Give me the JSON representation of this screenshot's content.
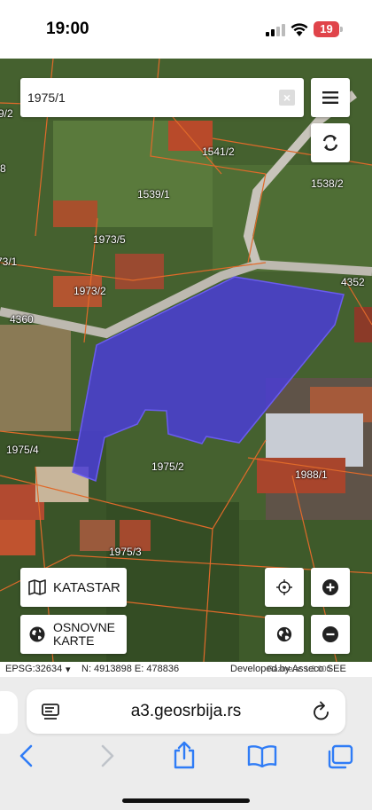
{
  "status_bar": {
    "time": "19:00",
    "battery": "19"
  },
  "search": {
    "value": "1975/1"
  },
  "parcels": [
    {
      "id": "p1",
      "label": "9/2"
    },
    {
      "id": "p2",
      "label": "1541/2"
    },
    {
      "id": "p3",
      "label": "8"
    },
    {
      "id": "p4",
      "label": "1538/2"
    },
    {
      "id": "p5",
      "label": "1539/1"
    },
    {
      "id": "p6",
      "label": "1973/5"
    },
    {
      "id": "p7",
      "label": "73/1"
    },
    {
      "id": "p8",
      "label": "1973/2"
    },
    {
      "id": "p9",
      "label": "4352"
    },
    {
      "id": "p10",
      "label": "4360"
    },
    {
      "id": "p11",
      "label": "1975/4"
    },
    {
      "id": "p12",
      "label": "1975/2"
    },
    {
      "id": "p13",
      "label": "1988/1"
    },
    {
      "id": "p14",
      "label": "1975/3"
    }
  ],
  "controls": {
    "katastar_label": "KATASTAR",
    "osnovne_label": "OSNOVNE KARTE"
  },
  "footer": {
    "epsg": "EPSG:32634",
    "coords": "N: 4913898 E: 478836",
    "developed": "Developed by Asseco SEE",
    "razmera": "Razmera: 1:3 000"
  },
  "browser": {
    "url": "a3.geosrbija.rs"
  },
  "colors": {
    "selected_parcel": "#4a3dd6",
    "parcel_border": "#e06a2a"
  }
}
